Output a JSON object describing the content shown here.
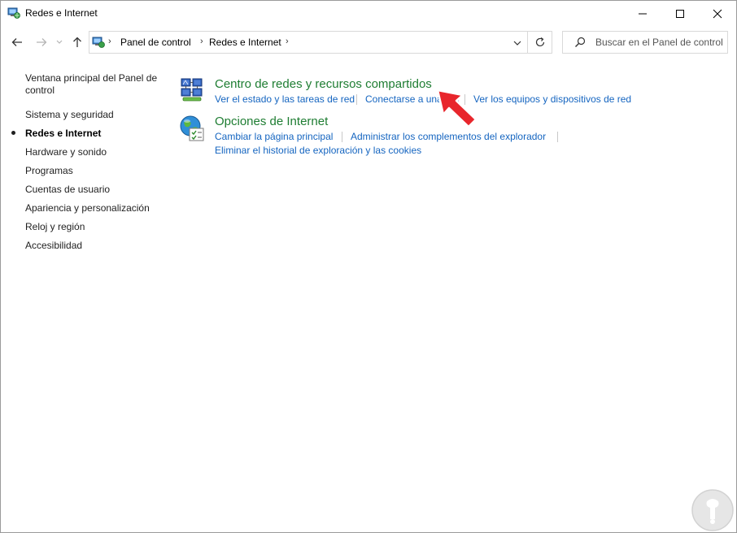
{
  "window": {
    "title": "Redes e Internet",
    "minimize_glyph": "—",
    "maximize_glyph": "☐",
    "close_glyph": "✕"
  },
  "address_bar": {
    "breadcrumbs": [
      "Panel de control",
      "Redes e Internet"
    ],
    "search_placeholder": "Buscar en el Panel de control"
  },
  "sidebar": {
    "items": [
      {
        "label": "Ventana principal del Panel de",
        "label2": "control"
      },
      {
        "label": "Sistema y seguridad"
      },
      {
        "label": "Redes e Internet",
        "current": true
      },
      {
        "label": "Hardware y sonido"
      },
      {
        "label": "Programas"
      },
      {
        "label": "Cuentas de usuario"
      },
      {
        "label": "Apariencia y personalización"
      },
      {
        "label": "Reloj y región"
      },
      {
        "label": "Accesibilidad"
      }
    ]
  },
  "categories": [
    {
      "title": "Centro de redes y recursos compartidos",
      "icon": "network-center-icon",
      "links": [
        "Ver el estado y las tareas de red",
        "Conectarse a una red",
        "Ver los equipos y dispositivos de red"
      ]
    },
    {
      "title": "Opciones de Internet",
      "icon": "internet-options-icon",
      "links": [
        "Cambiar la página principal",
        "Administrar los complementos del explorador",
        "Eliminar el historial de exploración y las cookies"
      ]
    }
  ],
  "colors": {
    "category_title": "#1e7d32",
    "link": "#1565c0",
    "annotation_arrow": "#e8262c"
  }
}
